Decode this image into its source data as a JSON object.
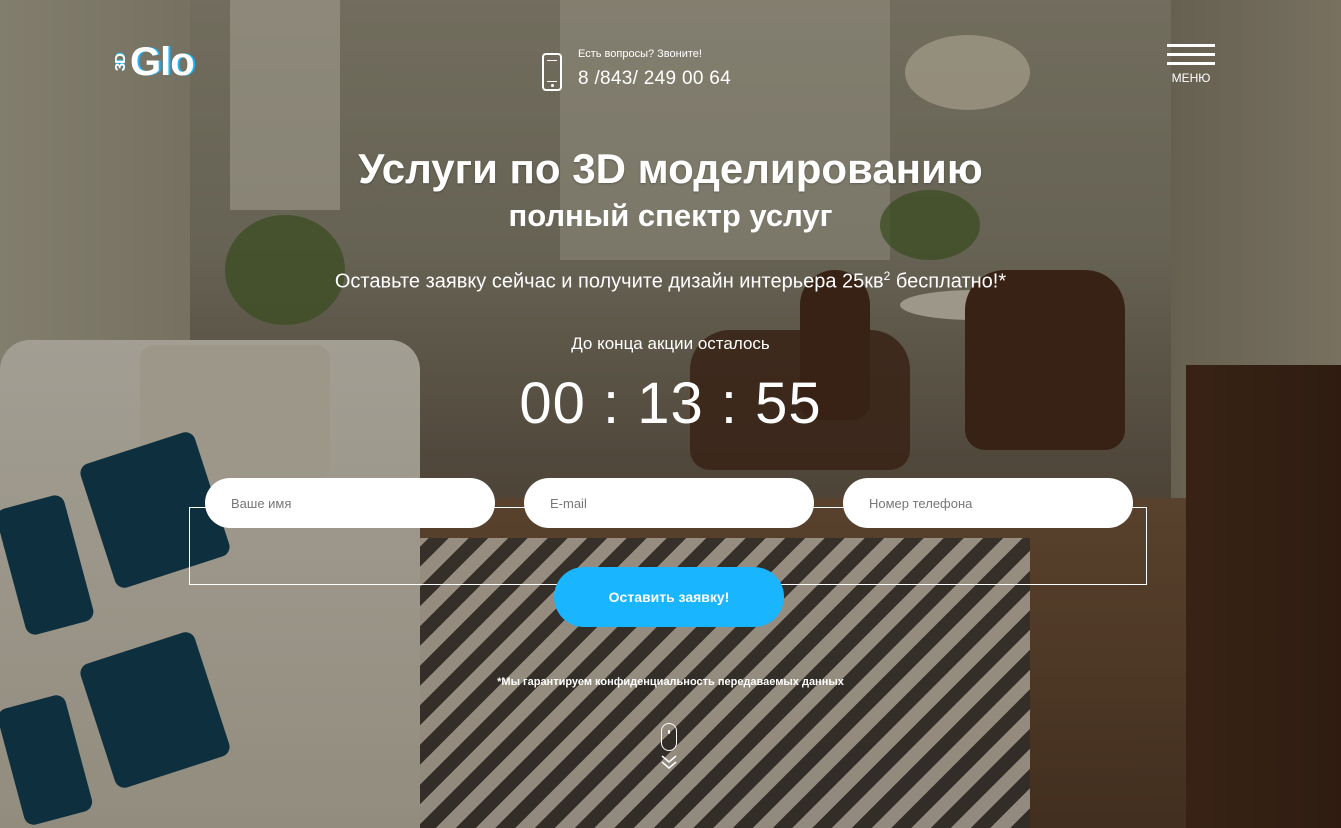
{
  "header": {
    "logo_mark": "3D",
    "logo_word": "Glo",
    "contact_prompt": "Есть вопросы? Звоните!",
    "phone": "8 /843/ 249 00 64",
    "menu_label": "МЕНЮ"
  },
  "hero": {
    "title": "Услуги по 3D моделированию",
    "subtitle": "полный спектр услуг",
    "offer_text": "Оставьте заявку сейчас и получите дизайн интерьера 25кв",
    "offer_sup": "2",
    "offer_suffix": " бесплатно!*",
    "timer_label": "До конца акции осталось",
    "timer_value": "00 : 13 : 55"
  },
  "form": {
    "name_placeholder": "Ваше имя",
    "email_placeholder": "E-mail",
    "phone_placeholder": "Номер телефона",
    "submit_label": "Оставить заявку!",
    "privacy_note": "*Мы гарантируем конфиденциальность передаваемых данных"
  },
  "colors": {
    "accent": "#19b5fe",
    "text": "#ffffff"
  }
}
